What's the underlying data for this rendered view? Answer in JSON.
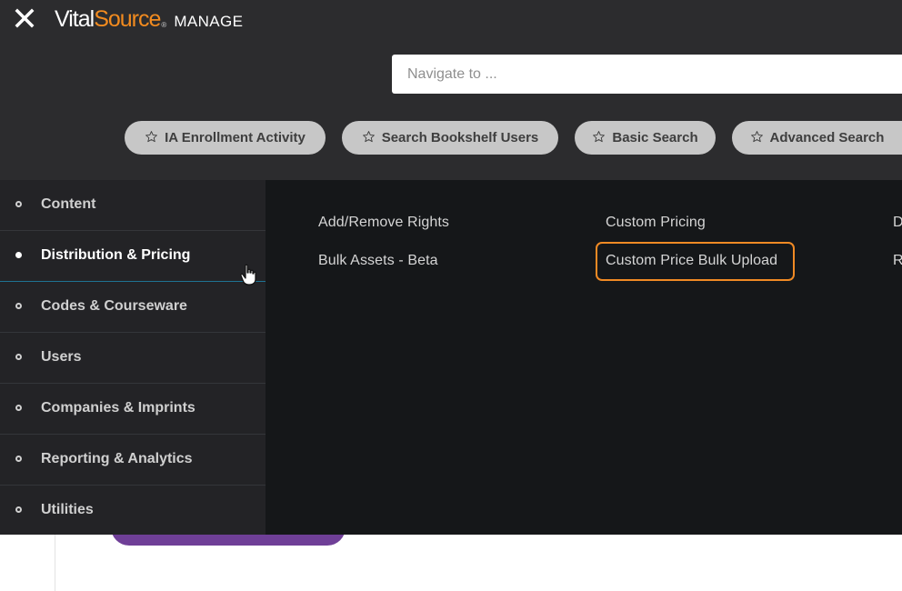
{
  "header": {
    "brand_vital": "Vital",
    "brand_source": "Source",
    "brand_tm": "®",
    "brand_product": "MANAGE"
  },
  "search": {
    "placeholder": "Navigate to ..."
  },
  "favorites": [
    {
      "label": "IA Enrollment Activity",
      "icon": "star-icon"
    },
    {
      "label": "Search Bookshelf Users",
      "icon": "star-icon"
    },
    {
      "label": "Basic Search",
      "icon": "star-icon"
    },
    {
      "label": "Advanced Search",
      "icon": "star-icon"
    }
  ],
  "sidebar": {
    "items": [
      {
        "label": "Content",
        "active": false
      },
      {
        "label": "Distribution & Pricing",
        "active": true
      },
      {
        "label": "Codes & Courseware",
        "active": false
      },
      {
        "label": "Users",
        "active": false
      },
      {
        "label": "Companies & Imprints",
        "active": false
      },
      {
        "label": "Reporting & Analytics",
        "active": false
      },
      {
        "label": "Utilities",
        "active": false
      }
    ]
  },
  "submenu": {
    "links": [
      {
        "label": "Add/Remove Rights"
      },
      {
        "label": "Bulk Assets - Beta"
      },
      {
        "label": "Custom Pricing"
      },
      {
        "label": "Custom Price Bulk Upload",
        "highlighted": true
      },
      {
        "label": "D"
      },
      {
        "label": "R"
      }
    ]
  },
  "colors": {
    "header_bg": "#2c2c2e",
    "menu_bg": "#151719",
    "sidebar_bg": "#232326",
    "brand_orange": "#f28b1f",
    "highlight_orange": "#f08a24",
    "active_underline": "#1f7393",
    "purple_button": "#6f3f97"
  },
  "icons": {
    "close": "close-icon",
    "favorite": "star-icon",
    "bullet": "sidebar-bullet-icon",
    "cursor": "cursor-icon"
  }
}
